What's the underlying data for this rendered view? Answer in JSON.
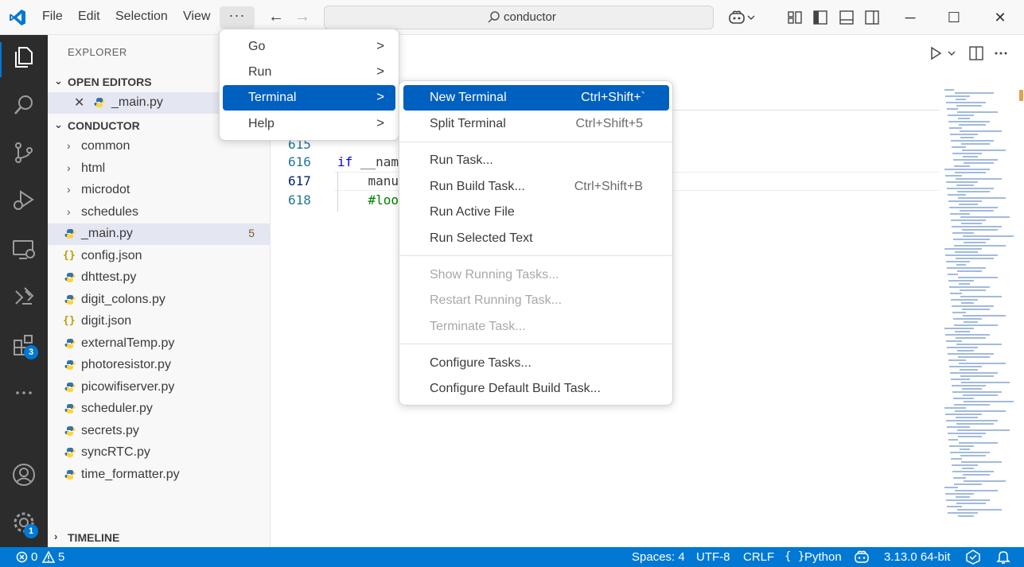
{
  "titlebar": {
    "menus": [
      "File",
      "Edit",
      "Selection",
      "View"
    ],
    "more_label": "···",
    "back_arrow": "←",
    "forward_arrow": "→",
    "search_text": "conductor",
    "minimize": "─",
    "maximize": "☐",
    "close": "✕"
  },
  "activitybar": {
    "extensions_badge": "3",
    "settings_badge": "1"
  },
  "sidebar": {
    "title": "EXPLORER",
    "open_editors_label": "OPEN EDITORS",
    "open_editor_file": "_main.py",
    "project_label": "CONDUCTOR",
    "folders": [
      "common",
      "html",
      "microdot",
      "schedules"
    ],
    "files": [
      {
        "name": "_main.py",
        "type": "py",
        "count": "5"
      },
      {
        "name": "config.json",
        "type": "json"
      },
      {
        "name": "dhttest.py",
        "type": "py"
      },
      {
        "name": "digit_colons.py",
        "type": "py"
      },
      {
        "name": "digit.json",
        "type": "json"
      },
      {
        "name": "externalTemp.py",
        "type": "py"
      },
      {
        "name": "photoresistor.py",
        "type": "py"
      },
      {
        "name": "picowifiserver.py",
        "type": "py"
      },
      {
        "name": "scheduler.py",
        "type": "py"
      },
      {
        "name": "secrets.py",
        "type": "py"
      },
      {
        "name": "syncRTC.py",
        "type": "py"
      },
      {
        "name": "time_formatter.py",
        "type": "py"
      }
    ],
    "timeline_label": "TIMELINE"
  },
  "editor": {
    "lines": [
      {
        "num": "615",
        "code": ""
      },
      {
        "num": "616",
        "kw": "if",
        "code": " __nam"
      },
      {
        "num": "617",
        "code": "    manu"
      },
      {
        "num": "618",
        "comment": "    #loo"
      }
    ]
  },
  "menu_more": {
    "items": [
      {
        "label": "Go",
        "arrow": ">"
      },
      {
        "label": "Run",
        "arrow": ">"
      },
      {
        "label": "Terminal",
        "arrow": ">"
      },
      {
        "label": "Help",
        "arrow": ">"
      }
    ]
  },
  "menu_terminal": {
    "groups": [
      [
        {
          "label": "New Terminal",
          "shortcut": "Ctrl+Shift+`"
        },
        {
          "label": "Split Terminal",
          "shortcut": "Ctrl+Shift+5"
        }
      ],
      [
        {
          "label": "Run Task...",
          "shortcut": ""
        },
        {
          "label": "Run Build Task...",
          "shortcut": "Ctrl+Shift+B"
        },
        {
          "label": "Run Active File",
          "shortcut": ""
        },
        {
          "label": "Run Selected Text",
          "shortcut": ""
        }
      ],
      [
        {
          "label": "Show Running Tasks...",
          "shortcut": ""
        },
        {
          "label": "Restart Running Task...",
          "shortcut": ""
        },
        {
          "label": "Terminate Task...",
          "shortcut": ""
        }
      ],
      [
        {
          "label": "Configure Tasks...",
          "shortcut": ""
        },
        {
          "label": "Configure Default Build Task...",
          "shortcut": ""
        }
      ]
    ]
  },
  "statusbar": {
    "errors": "0",
    "warnings": "5",
    "spaces": "Spaces: 4",
    "encoding": "UTF-8",
    "eol": "CRLF",
    "language_braces": "{ }",
    "language": "Python",
    "interpreter": "3.13.0 64-bit"
  },
  "colors": {
    "accent": "#0078d4",
    "menu_highlight": "#0060c0",
    "activity_bg": "#2c2c2c"
  }
}
